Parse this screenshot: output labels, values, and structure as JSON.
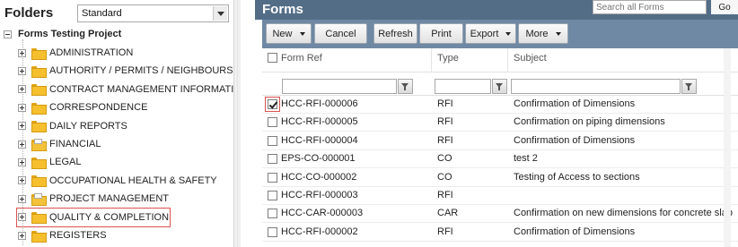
{
  "folders_pane": {
    "title": "Folders",
    "view_select": "Standard",
    "root": "Forms Testing Project",
    "items": [
      {
        "label": "ADMINISTRATION",
        "icon": "folder-icon"
      },
      {
        "label": "AUTHORITY / PERMITS / NEIGHBOURS",
        "icon": "folder-icon"
      },
      {
        "label": "CONTRACT MANAGEMENT INFORMATION",
        "icon": "folder-icon"
      },
      {
        "label": "CORRESPONDENCE",
        "icon": "folder-icon"
      },
      {
        "label": "DAILY REPORTS",
        "icon": "folder-icon"
      },
      {
        "label": "FINANCIAL",
        "icon": "folder-document-icon"
      },
      {
        "label": "LEGAL",
        "icon": "folder-icon"
      },
      {
        "label": "OCCUPATIONAL HEALTH & SAFETY",
        "icon": "folder-icon"
      },
      {
        "label": "PROJECT MANAGEMENT",
        "icon": "folder-document-icon"
      },
      {
        "label": "QUALITY & COMPLETION",
        "icon": "folder-icon",
        "selected": true
      },
      {
        "label": "REGISTERS",
        "icon": "folder-icon"
      }
    ]
  },
  "forms_pane": {
    "title": "Forms",
    "search_placeholder": "Search all Forms",
    "go_label": "Go",
    "toolbar": {
      "new": "New",
      "cancel": "Cancel",
      "refresh": "Refresh",
      "print": "Print",
      "export": "Export",
      "more": "More"
    },
    "columns": {
      "form_ref": "Form Ref",
      "type": "Type",
      "subject": "Subject"
    },
    "rows": [
      {
        "checked": true,
        "ref": "HCC-RFI-000006",
        "type": "RFI",
        "subject": "Confirmation of Dimensions"
      },
      {
        "checked": false,
        "ref": "HCC-RFI-000005",
        "type": "RFI",
        "subject": "Confirmation on piping dimensions"
      },
      {
        "checked": false,
        "ref": "HCC-RFI-000004",
        "type": "RFI",
        "subject": "Confirmation of Dimensions"
      },
      {
        "checked": false,
        "ref": "EPS-CO-000001",
        "type": "CO",
        "subject": "test 2"
      },
      {
        "checked": false,
        "ref": "HCC-CO-000002",
        "type": "CO",
        "subject": "Testing of Access to sections"
      },
      {
        "checked": false,
        "ref": "HCC-RFI-000003",
        "type": "RFI",
        "subject": ""
      },
      {
        "checked": false,
        "ref": "HCC-CAR-000003",
        "type": "CAR",
        "subject": "Confirmation on new dimensions for concrete slab"
      },
      {
        "checked": false,
        "ref": "HCC-RFI-000002",
        "type": "RFI",
        "subject": "Confirmation of Dimensions"
      }
    ]
  },
  "colors": {
    "header_bg": "#536d87",
    "toolbar_bg": "#6f88a3",
    "selection_outline": "#d9534f",
    "folder": "#f5bf2e"
  }
}
